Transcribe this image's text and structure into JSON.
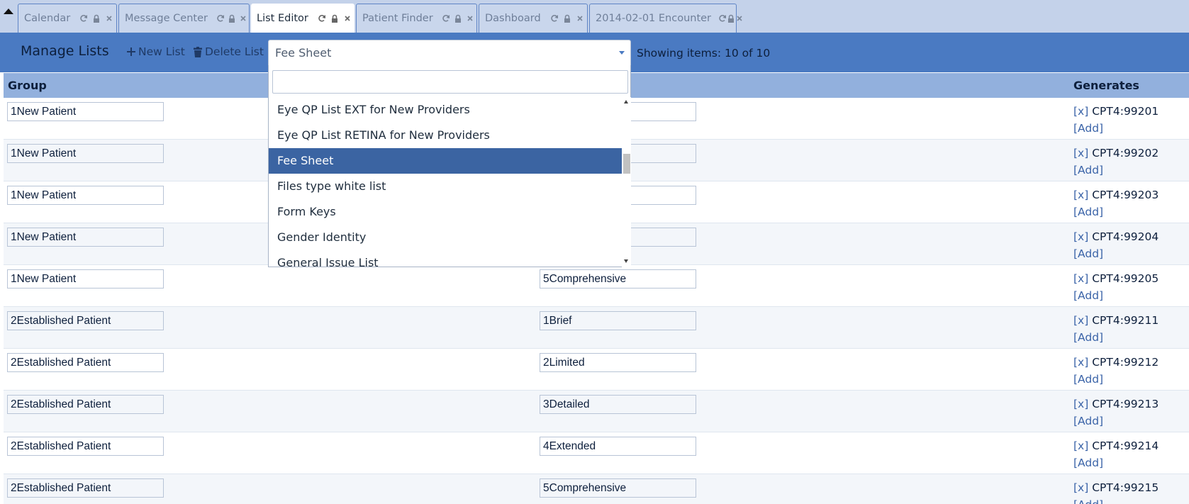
{
  "tabs": [
    {
      "label": "Calendar",
      "active": false
    },
    {
      "label": "Message Center",
      "active": false
    },
    {
      "label": "List Editor",
      "active": true
    },
    {
      "label": "Patient Finder",
      "active": false
    },
    {
      "label": "Dashboard",
      "active": false
    },
    {
      "label": "2014-02-01 Encounter",
      "active": false
    }
  ],
  "header": {
    "title": "Manage Lists",
    "new_list": "New List",
    "delete_list": "Delete List",
    "selected_list": "Fee Sheet",
    "showing": "Showing items: 10 of 10"
  },
  "table": {
    "col_group": "Group",
    "col_generates": "Generates",
    "rows": [
      {
        "group": "1New Patient",
        "value": "",
        "code": "CPT4:99201"
      },
      {
        "group": "1New Patient",
        "value": "",
        "code": "CPT4:99202"
      },
      {
        "group": "1New Patient",
        "value": "",
        "code": "CPT4:99203"
      },
      {
        "group": "1New Patient",
        "value": "",
        "code": "CPT4:99204"
      },
      {
        "group": "1New Patient",
        "value": "5Comprehensive",
        "code": "CPT4:99205"
      },
      {
        "group": "2Established Patient",
        "value": "1Brief",
        "code": "CPT4:99211"
      },
      {
        "group": "2Established Patient",
        "value": "2Limited",
        "code": "CPT4:99212"
      },
      {
        "group": "2Established Patient",
        "value": "3Detailed",
        "code": "CPT4:99213"
      },
      {
        "group": "2Established Patient",
        "value": "4Extended",
        "code": "CPT4:99214"
      },
      {
        "group": "2Established Patient",
        "value": "5Comprehensive",
        "code": "CPT4:99215"
      }
    ],
    "remove_label": "[x]",
    "add_label": "[Add]"
  },
  "dropdown": {
    "search_value": "",
    "items": [
      {
        "label": "Eye QP List EXT for New Providers",
        "selected": false
      },
      {
        "label": "Eye QP List RETINA for New Providers",
        "selected": false
      },
      {
        "label": "Fee Sheet",
        "selected": true
      },
      {
        "label": "Files type white list",
        "selected": false
      },
      {
        "label": "Form Keys",
        "selected": false
      },
      {
        "label": "Gender Identity",
        "selected": false
      },
      {
        "label": "General Issue List",
        "selected": false
      }
    ]
  },
  "colors": {
    "header_bg": "#4a7ac2",
    "table_header_bg": "#92b0dd",
    "selected_item_bg": "#3b64a2",
    "link": "#3b64a8"
  },
  "icons": {
    "tab_refresh": "refresh-icon",
    "tab_lock": "lock-icon",
    "tab_close": "close-icon",
    "new_list": "plus-icon",
    "delete_list": "trash-icon",
    "collapse": "caret-up-icon"
  }
}
